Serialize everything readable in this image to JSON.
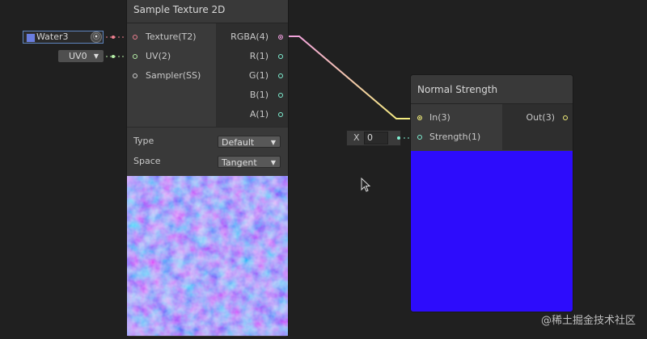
{
  "sample_node": {
    "title": "Sample Texture 2D",
    "inputs": [
      {
        "label": "Texture(T2)",
        "color": "#f08090"
      },
      {
        "label": "UV(2)",
        "color": "#b6f0a8"
      },
      {
        "label": "Sampler(SS)",
        "color": "#cfcfcf"
      }
    ],
    "outputs": [
      {
        "label": "RGBA(4)",
        "color": "#f2a0e0"
      },
      {
        "label": "R(1)",
        "color": "#7ff0d2"
      },
      {
        "label": "G(1)",
        "color": "#7ff0d2"
      },
      {
        "label": "B(1)",
        "color": "#7ff0d2"
      },
      {
        "label": "A(1)",
        "color": "#7ff0d2"
      }
    ],
    "controls": {
      "type_label": "Type",
      "type_value": "Default",
      "space_label": "Space",
      "space_value": "Tangent"
    }
  },
  "texture_field": {
    "value": "Water3",
    "picker_icon": "target-icon"
  },
  "uv_field": {
    "value": "UV0"
  },
  "strength_node": {
    "title": "Normal Strength",
    "inputs": [
      {
        "label": "In(3)",
        "color": "#f4f07a"
      },
      {
        "label": "Strength(1)",
        "color": "#7ff0d2"
      }
    ],
    "outputs": [
      {
        "label": "Out(3)",
        "color": "#f4f07a"
      }
    ],
    "preview_color": "#2d0cfc"
  },
  "strength_field": {
    "axis": "X",
    "value": "0"
  },
  "watermark": "@稀土掘金技术社区",
  "colors": {
    "background": "#202020",
    "node": "#393939",
    "wire_start": "#f2a0e0",
    "wire_end": "#f4f07a"
  }
}
